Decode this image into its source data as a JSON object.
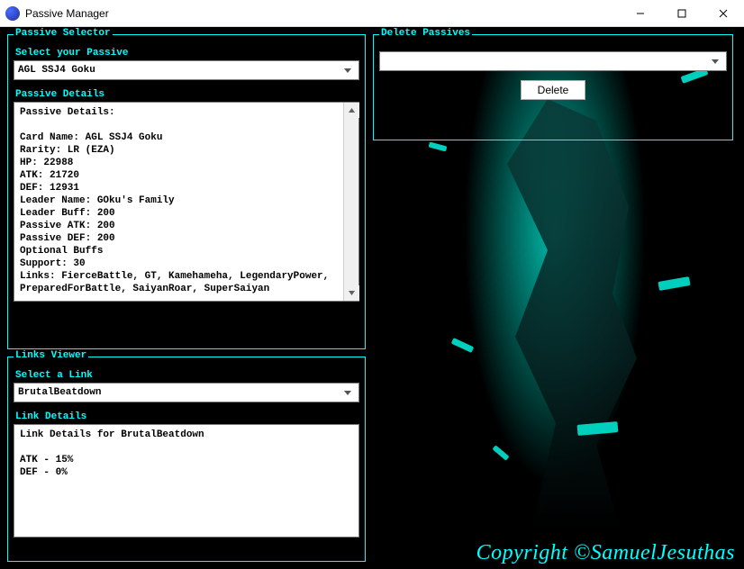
{
  "window": {
    "title": "Passive Manager"
  },
  "passive_selector": {
    "legend": "Passive Selector",
    "select_label": "Select your Passive",
    "selected_value": "AGL SSJ4 Goku",
    "details_title": "Passive Details",
    "details_text": "Passive Details:\n\nCard Name: AGL SSJ4 Goku\nRarity: LR (EZA)\nHP: 22988\nATK: 21720\nDEF: 12931\nLeader Name: GOku's Family\nLeader Buff: 200\nPassive ATK: 200\nPassive DEF: 200\nOptional Buffs\nSupport: 30\nLinks: FierceBattle, GT, Kamehameha, LegendaryPower, PreparedForBattle, SaiyanRoar, SuperSaiyan\n\n"
  },
  "links_viewer": {
    "legend": "Links Viewer",
    "select_label": "Select a Link",
    "selected_value": "BrutalBeatdown",
    "details_title": "Link Details",
    "details_text": "Link Details for BrutalBeatdown\n\nATK - 15%\nDEF - 0%"
  },
  "delete_passives": {
    "legend": "Delete Passives",
    "selected_value": "",
    "delete_button": "Delete"
  },
  "copyright": "Copyright ©SamuelJesuthas"
}
